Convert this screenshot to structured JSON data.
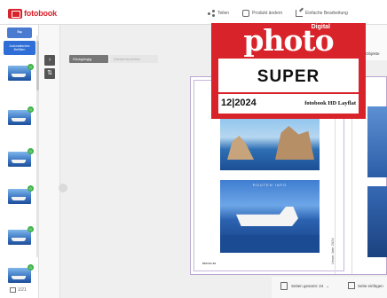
{
  "app": {
    "logo_text": "fotobook"
  },
  "toolbar": {
    "share_label": "Teilen",
    "product_label": "Produkt ändern",
    "editor_label": "Einfache Bearbeitung"
  },
  "left_panel": {
    "button_label": "Automatisches Befüllen",
    "thumbnails": [
      {
        "badge": "0"
      },
      {
        "badge": "0"
      },
      {
        "badge": "0"
      },
      {
        "badge": "0"
      },
      {
        "badge": "0"
      },
      {
        "badge": "0"
      },
      {
        "badge": "0"
      }
    ],
    "page_count": "1/21"
  },
  "canvas": {
    "undo_label": "Rückgängig",
    "redo_label": "Wiederherstellen",
    "cruise_caption": "ROUTEN INFO",
    "footer_text": "2024 01 09",
    "spine_text": "Unser Jahr 2024"
  },
  "right_panel": {
    "objects_tab": "Objekte"
  },
  "badge": {
    "digital": "Digital",
    "brand": "photo",
    "award": "SUPER",
    "issue": "12|2024",
    "product": "fotobook HD Layflat",
    "color": "#d8232a"
  },
  "bottom": {
    "pages_label": "Seiten gesamt: 24",
    "add_label": "Seite einfügen"
  }
}
